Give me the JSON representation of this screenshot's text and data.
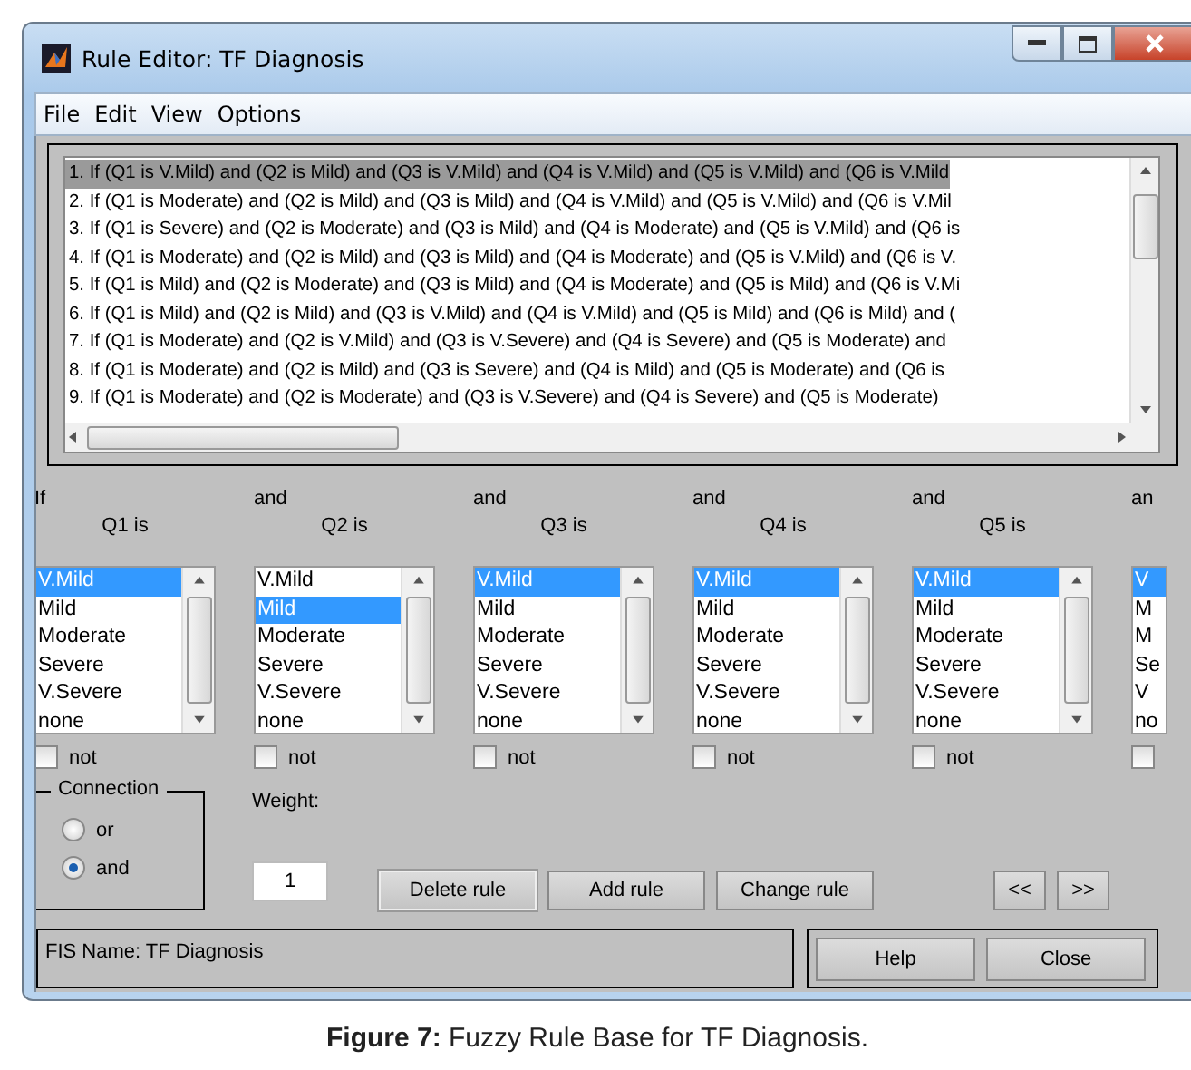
{
  "window": {
    "title": "Rule Editor: TF Diagnosis"
  },
  "menu": [
    "File",
    "Edit",
    "View",
    "Options"
  ],
  "rules": [
    {
      "text": "1. If (Q1 is V.Mild) and (Q2 is Mild) and (Q3 is V.Mild) and (Q4 is V.Mild) and (Q5 is V.Mild) and (Q6 is V.Mild",
      "selected": true
    },
    {
      "text": "2. If (Q1 is Moderate) and (Q2 is Mild) and (Q3 is Mild) and (Q4 is V.Mild) and (Q5 is V.Mild) and (Q6 is V.Mil",
      "selected": false
    },
    {
      "text": "3. If (Q1 is Severe) and (Q2 is Moderate) and (Q3 is Mild) and (Q4 is Moderate) and (Q5 is V.Mild) and (Q6 is",
      "selected": false
    },
    {
      "text": "4. If (Q1 is Moderate) and (Q2 is Mild) and (Q3 is Mild) and (Q4 is Moderate) and (Q5 is V.Mild) and (Q6 is V.",
      "selected": false
    },
    {
      "text": "5. If (Q1 is Mild) and (Q2 is Moderate) and (Q3 is Mild) and (Q4 is Moderate) and (Q5 is Mild) and (Q6 is V.Mi",
      "selected": false
    },
    {
      "text": "6. If (Q1 is Mild) and (Q2 is Mild) and (Q3 is V.Mild) and (Q4 is V.Mild) and (Q5 is Mild) and (Q6 is Mild) and (",
      "selected": false
    },
    {
      "text": "7. If (Q1 is Moderate) and (Q2 is V.Mild) and (Q3 is V.Severe) and (Q4 is Severe) and (Q5 is Moderate) and",
      "selected": false
    },
    {
      "text": "8. If (Q1 is Moderate) and (Q2 is Mild) and (Q3 is Severe) and (Q4 is Mild) and (Q5 is Moderate) and (Q6 is",
      "selected": false
    },
    {
      "text": "9. If (Q1 is Moderate) and (Q2 is Moderate) and (Q3 is V.Severe) and (Q4 is Severe) and (Q5 is Moderate)",
      "selected": false
    }
  ],
  "antecedents": [
    {
      "connector": "If",
      "label": "Q1 is",
      "not_label": "not",
      "not_checked": false,
      "options": [
        {
          "text": "V.Mild",
          "selected": true
        },
        {
          "text": "Mild",
          "selected": false
        },
        {
          "text": "Moderate",
          "selected": false
        },
        {
          "text": "Severe",
          "selected": false
        },
        {
          "text": "V.Severe",
          "selected": false
        },
        {
          "text": "none",
          "selected": false
        }
      ]
    },
    {
      "connector": "and",
      "label": "Q2 is",
      "not_label": "not",
      "not_checked": false,
      "options": [
        {
          "text": "V.Mild",
          "selected": false
        },
        {
          "text": "Mild",
          "selected": true
        },
        {
          "text": "Moderate",
          "selected": false
        },
        {
          "text": "Severe",
          "selected": false
        },
        {
          "text": "V.Severe",
          "selected": false
        },
        {
          "text": "none",
          "selected": false
        }
      ]
    },
    {
      "connector": "and",
      "label": "Q3 is",
      "not_label": "not",
      "not_checked": false,
      "options": [
        {
          "text": "V.Mild",
          "selected": true
        },
        {
          "text": "Mild",
          "selected": false
        },
        {
          "text": "Moderate",
          "selected": false
        },
        {
          "text": "Severe",
          "selected": false
        },
        {
          "text": "V.Severe",
          "selected": false
        },
        {
          "text": "none",
          "selected": false
        }
      ]
    },
    {
      "connector": "and",
      "label": "Q4 is",
      "not_label": "not",
      "not_checked": false,
      "options": [
        {
          "text": "V.Mild",
          "selected": true
        },
        {
          "text": "Mild",
          "selected": false
        },
        {
          "text": "Moderate",
          "selected": false
        },
        {
          "text": "Severe",
          "selected": false
        },
        {
          "text": "V.Severe",
          "selected": false
        },
        {
          "text": "none",
          "selected": false
        }
      ]
    },
    {
      "connector": "and",
      "label": "Q5 is",
      "not_label": "not",
      "not_checked": false,
      "options": [
        {
          "text": "V.Mild",
          "selected": true
        },
        {
          "text": "Mild",
          "selected": false
        },
        {
          "text": "Moderate",
          "selected": false
        },
        {
          "text": "Severe",
          "selected": false
        },
        {
          "text": "V.Severe",
          "selected": false
        },
        {
          "text": "none",
          "selected": false
        }
      ]
    },
    {
      "connector": "an",
      "not_checked": false,
      "options": [
        {
          "text": "V",
          "selected": true
        },
        {
          "text": "M",
          "selected": false
        },
        {
          "text": "M",
          "selected": false
        },
        {
          "text": "Se",
          "selected": false
        },
        {
          "text": "V",
          "selected": false
        },
        {
          "text": "no",
          "selected": false
        }
      ]
    }
  ],
  "connection": {
    "title": "Connection",
    "options": [
      {
        "label": "or",
        "selected": false
      },
      {
        "label": "and",
        "selected": true
      }
    ]
  },
  "weight": {
    "label": "Weight:",
    "value": "1"
  },
  "buttons": [
    "Delete rule",
    "Add rule",
    "Change rule"
  ],
  "nav_buttons": [
    "<<",
    ">>"
  ],
  "status": "FIS Name: TF Diagnosis",
  "footer_buttons": [
    "Help",
    "Close"
  ],
  "caption": "**Figure 7:** Fuzzy Rule Base for TF Diagnosis."
}
